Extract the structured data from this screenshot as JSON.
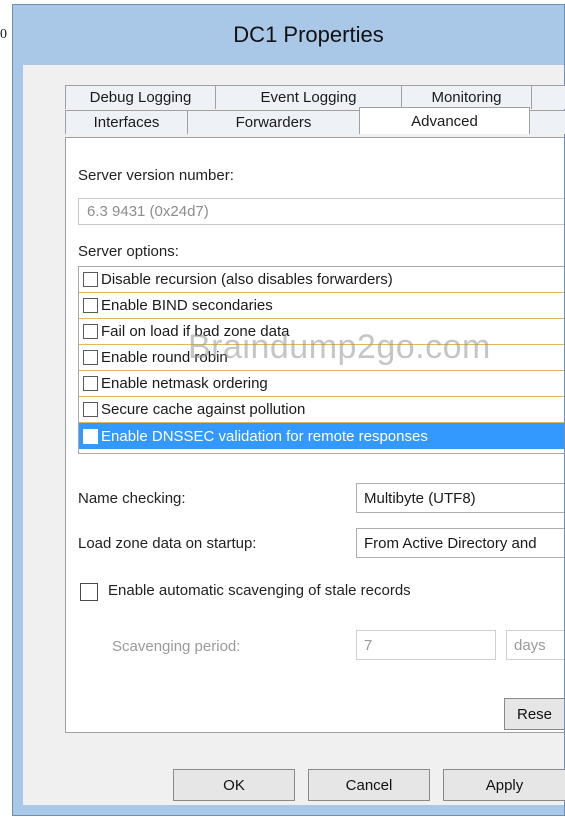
{
  "edge_text": "0",
  "window": {
    "title": "DC1 Properties"
  },
  "tabs": {
    "row1": [
      "Debug Logging",
      "Event Logging",
      "Monitoring"
    ],
    "row2": [
      "Interfaces",
      "Forwarders",
      "Advanced"
    ],
    "active": "Advanced"
  },
  "advanced": {
    "version_label": "Server version number:",
    "version_value": "6.3 9431 (0x24d7)",
    "options_label": "Server options:",
    "options": [
      {
        "label": "Disable recursion (also disables forwarders)",
        "checked": false,
        "selected": false
      },
      {
        "label": "Enable BIND secondaries",
        "checked": false,
        "selected": false
      },
      {
        "label": "Fail on load if bad zone data",
        "checked": false,
        "selected": false
      },
      {
        "label": "Enable round robin",
        "checked": false,
        "selected": false
      },
      {
        "label": "Enable netmask ordering",
        "checked": false,
        "selected": false
      },
      {
        "label": "Secure cache against pollution",
        "checked": false,
        "selected": false
      },
      {
        "label": "Enable DNSSEC validation for remote responses",
        "checked": false,
        "selected": true
      }
    ],
    "name_checking_label": "Name checking:",
    "name_checking_value": "Multibyte (UTF8)",
    "load_zone_label": "Load zone data on startup:",
    "load_zone_value": "From Active Directory and",
    "scavenging_label": "Enable automatic scavenging of stale records",
    "scavenging_checked": false,
    "scavenging_period_label": "Scavenging period:",
    "scavenging_period_value": "7",
    "scavenging_unit": "days",
    "reset_label": "Rese"
  },
  "buttons": {
    "ok": "OK",
    "cancel": "Cancel",
    "apply": "Apply"
  },
  "watermark": "Braindump2go.com"
}
